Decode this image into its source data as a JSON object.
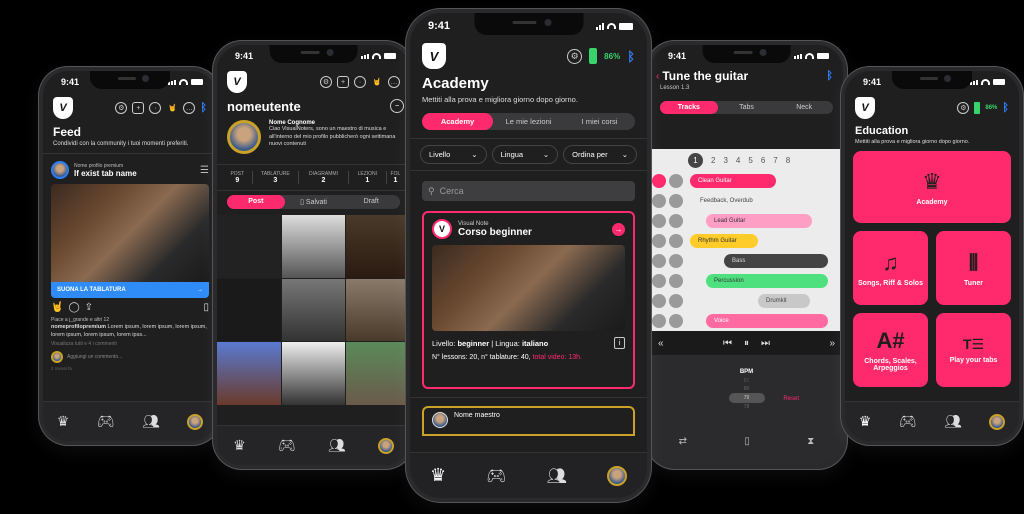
{
  "status_time": "9:41",
  "phones": {
    "feed": {
      "title": "Feed",
      "subtitle": "Condividi con la community i tuoi momenti preferiti.",
      "post": {
        "account_label": "Nome profilo premium",
        "tab_name": "If exist tab name",
        "cta": "SUONA LA TABLATURA",
        "likes_text": "Piace a j_grande e altri 12",
        "caption_user": "nomeprofilopremium",
        "caption_text": "Lorem ipsum, lorem ipsum, lorem ipsum, lorem ipsum, lorem ipsum, lorem ipss...",
        "view_comments": "Visualizza tutti e 4 i commenti",
        "add_comment_placeholder": "Aggiungi un commento...",
        "time_ago": "2 minuti fa"
      }
    },
    "profile": {
      "username": "nomeutente",
      "full_name": "Nome Cognome",
      "bio": "Ciao VisualNoters, sono un maestro di musica e all'interno del mio profilo pubblicherò ogni settimana nuovi contenuti",
      "stats": [
        {
          "label": "POST",
          "value": "9"
        },
        {
          "label": "TABLATURE",
          "value": "3"
        },
        {
          "label": "DIAGRAMMI",
          "value": "2"
        },
        {
          "label": "LEZIONI",
          "value": "1"
        },
        {
          "label": "FOL",
          "value": "1"
        }
      ],
      "tabs": [
        "Post",
        "Salvati",
        "Draft"
      ],
      "active_tab": "Post"
    },
    "academy": {
      "title": "Academy",
      "subtitle": "Mettiti alla prova e migliora giorno dopo giorno.",
      "battery": "86%",
      "tabs": [
        "Academy",
        "Le mie lezioni",
        "I miei corsi"
      ],
      "active_tab": "Academy",
      "filters": [
        "Livello",
        "Lingua",
        "Ordina per"
      ],
      "search_placeholder": "Cerca",
      "course": {
        "provider": "Visual Note",
        "name": "Corso beginner",
        "level_label": "Livello:",
        "level": "beginner",
        "language_label": "Lingua:",
        "language": "italiano",
        "stats_text": "N° lessons: 20, n° tablature: 40,",
        "total_video": "total video: 13h."
      },
      "next_card_teacher": "Nome maestro"
    },
    "tune": {
      "title": "Tune the guitar",
      "lesson": "Lesson 1.3",
      "tabs": [
        "Tracks",
        "Tabs",
        "Neck"
      ],
      "active_tab": "Tracks",
      "measures": [
        "1",
        "2",
        "3",
        "4",
        "5",
        "6",
        "7",
        "8"
      ],
      "active_measure": "1",
      "tracks": [
        {
          "name": "Clean Guitar",
          "color": "#ff2a6d"
        },
        {
          "name": "Feedback, Overdub",
          "color": ""
        },
        {
          "name": "Lead Guitar",
          "color": "#ff9ec4"
        },
        {
          "name": "Rhythm Guitar",
          "color": "#ffcc29"
        },
        {
          "name": "Bass",
          "color": "#444444"
        },
        {
          "name": "Percussion",
          "color": "#4ee07f"
        },
        {
          "name": "Drumkit",
          "color": "#c8c8c8"
        },
        {
          "name": "Voice",
          "color": "#ff6aa0"
        }
      ],
      "bpm_label": "BPM",
      "bpm_options": [
        "81",
        "80",
        "79",
        "78",
        "77"
      ],
      "bpm_value": "79",
      "reset_label": "Reset"
    },
    "education": {
      "title": "Education",
      "subtitle": "Mettiti alla prova e migliora giorno dopo giorno.",
      "battery": "86%",
      "tiles": [
        {
          "label": "Academy",
          "icon": "crown-icon"
        },
        {
          "label": "Songs, Riff & Solos",
          "icon": "music-note-icon"
        },
        {
          "label": "Tuner",
          "icon": "tuner-icon"
        },
        {
          "label": "Chords, Scales, Arpeggios",
          "icon": "a-sharp-icon"
        },
        {
          "label": "Play your tabs",
          "icon": "tab-icon"
        }
      ]
    }
  },
  "colors": {
    "accent": "#ff2a6d",
    "gold": "#c9a227",
    "blue": "#2f7ef7",
    "battery": "#38d36b"
  }
}
